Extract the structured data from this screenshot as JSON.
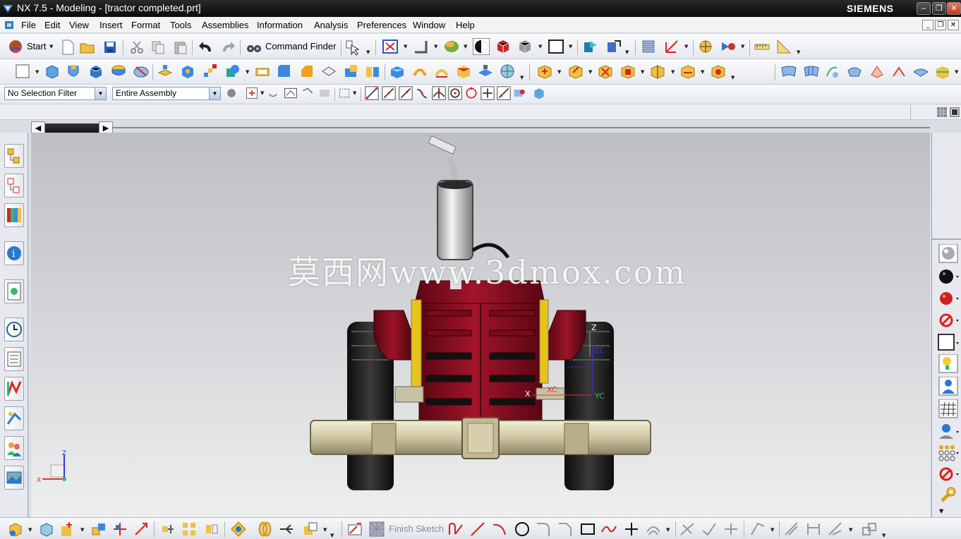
{
  "window": {
    "title": "NX 7.5 - Modeling - [tractor completed.prt]",
    "brand": "SIEMENS",
    "minimize": "‒",
    "restore": "❐",
    "close": "✕"
  },
  "menubar": {
    "items": [
      "File",
      "Edit",
      "View",
      "Insert",
      "Format",
      "Tools",
      "Assemblies",
      "Information",
      "Analysis",
      "Preferences",
      "Window",
      "Help"
    ]
  },
  "toolbar": {
    "start_label": "Start",
    "command_finder_label": "Command Finder"
  },
  "selection": {
    "filter": "No Selection Filter",
    "scope": "Entire Assembly"
  },
  "sketch": {
    "finish_label": "Finish Sketch"
  },
  "viewport": {
    "watermark": "莫西网www.3dmox.com",
    "triad_labels": {
      "x": "X",
      "y": "Y",
      "z": "Z"
    },
    "wcs_labels": {
      "x": "X",
      "xc": "XC",
      "yc": "YC",
      "zc": "ZC",
      "z": "Z"
    }
  },
  "colors": {
    "body": "#7d0a18",
    "grille_trim": "#e6c419",
    "bumper": "#d6cfb0",
    "tire": "#1a1a1a",
    "viewport_top": "#bdbfc4",
    "viewport_bottom": "#eeefef"
  }
}
